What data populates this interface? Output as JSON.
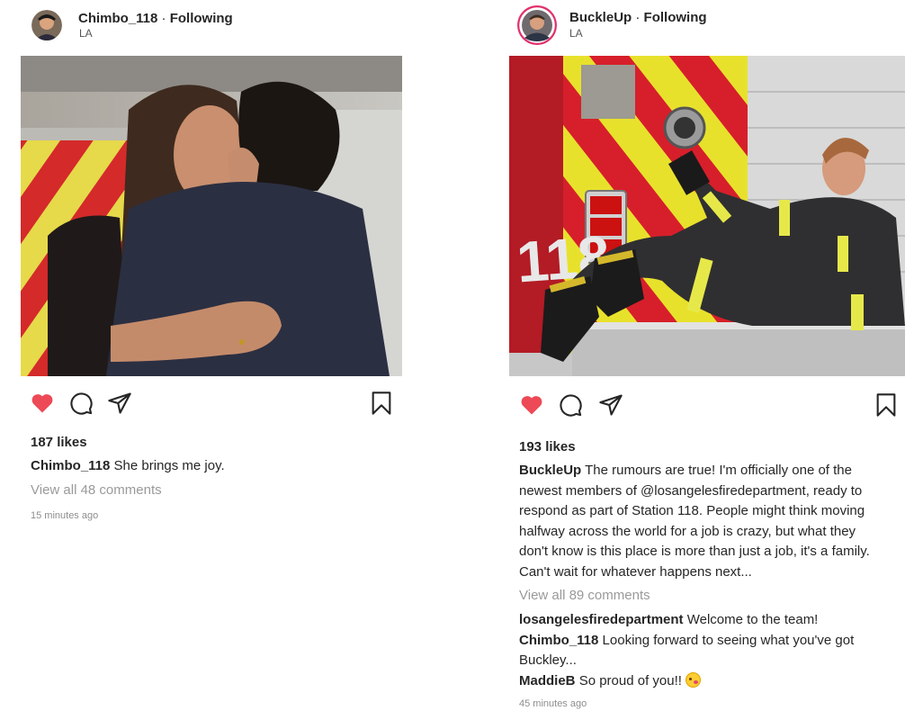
{
  "posts": [
    {
      "username": "Chimbo_118",
      "separator": "·",
      "follow_status": "Following",
      "location": "LA",
      "likes": "187 likes",
      "caption_user": "Chimbo_118",
      "caption_text": "She brings me joy.",
      "view_comments": "View all 48 comments",
      "timestamp": "15 minutes ago",
      "liked": true
    },
    {
      "username": "BuckleUp",
      "separator": "·",
      "follow_status": "Following",
      "location": "LA",
      "likes": "193 likes",
      "caption_user": "BuckleUp",
      "caption_lines": [
        "The rumours are true! I'm officially one of the",
        "newest members of @losangelesfiredepartment, ready to",
        "respond as part of Station 118. People might think moving",
        "halfway across the world for a job is crazy, but what they",
        "don't know is this place is more than just a job, it's a family.",
        "Can't wait for whatever happens next..."
      ],
      "view_comments": "View all 89 comments",
      "comments": [
        {
          "user": "losangelesfiredepartment",
          "text": "Welcome to the team!"
        },
        {
          "user": "Chimbo_118",
          "text": "Looking forward to seeing what you've got"
        },
        {
          "user": "",
          "text": "Buckley..."
        },
        {
          "user": "MaddieB",
          "text": "So proud of you!!"
        }
      ],
      "emoji": "face-blowing-kiss",
      "timestamp": "45 minutes ago",
      "liked": true,
      "truck_number": "118"
    }
  ],
  "colors": {
    "heart": "#ed4956",
    "muted": "#9a9a9a",
    "text": "#262626",
    "story_ring": "#e1306c"
  },
  "icons": [
    "heart-icon",
    "comment-icon",
    "share-icon",
    "bookmark-icon"
  ]
}
